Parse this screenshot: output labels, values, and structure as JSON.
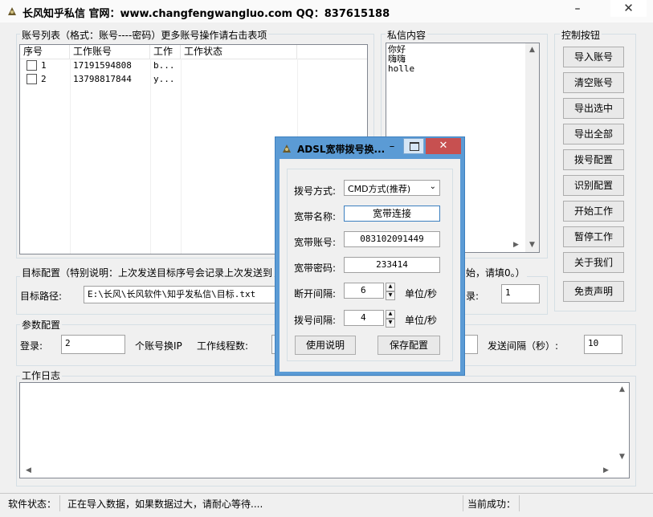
{
  "app": {
    "title": "长风知乎私信 官网：www.changfengwangluo.com QQ：837615188",
    "min": "–",
    "close": "✕"
  },
  "accounts": {
    "legend": "账号列表（格式：账号----密码）更多账号操作请右击表项",
    "columns": [
      "序号",
      "工作账号",
      "工作",
      "工作状态"
    ],
    "rows": [
      {
        "no": "1",
        "account": "17191594808",
        "work": "b..."
      },
      {
        "no": "2",
        "account": "13798817844",
        "work": "y..."
      }
    ]
  },
  "message": {
    "legend": "私信内容",
    "lines": [
      "你好",
      "嗨嗨",
      "holle"
    ]
  },
  "controls": {
    "legend": "控制按钮",
    "buttons": [
      "导入账号",
      "清空账号",
      "导出选中",
      "导出全部",
      "拨号配置",
      "识别配置",
      "开始工作",
      "暂停工作",
      "关于我们",
      "免责声明"
    ]
  },
  "target": {
    "legend": "目标配置（特别说明：上次发送目标序号会记录上次发送到",
    "legend_tail": "始，请填0。）",
    "path_label": "目标路径:",
    "path_value": "E:\\长风\\长风软件\\知乎发私信\\目标.txt",
    "record_label": "录:",
    "record_value": "1"
  },
  "params": {
    "legend": "参数配置",
    "login_label": "登录:",
    "login_value": "2",
    "ip_label": "个账号换IP",
    "threads_label": "工作线程数:",
    "interval_label": "发送间隔（秒）:",
    "interval_value": "10"
  },
  "log": {
    "legend": "工作日志"
  },
  "status": {
    "label": "软件状态：",
    "text": "正在导入数据，如果数据过大，请耐心等待....",
    "success_label": "当前成功："
  },
  "dialog": {
    "title": "ADSL宽带拨号换...",
    "min": "–",
    "close": "✕",
    "dial_label": "拨号方式:",
    "dial_value": "CMD方式(推荐)",
    "name_label": "宽带名称:",
    "name_value": "宽带连接",
    "acct_label": "宽带账号:",
    "acct_value": "083102091449",
    "pwd_label": "宽带密码:",
    "pwd_value": "233414",
    "disc_label": "断开间隔:",
    "disc_value": "6",
    "disc_unit": "单位/秒",
    "redial_label": "拨号间隔:",
    "redial_value": "4",
    "redial_unit": "单位/秒",
    "help_btn": "使用说明",
    "save_btn": "保存配置"
  },
  "colors": {
    "dialog_frame": "#5b9bd5",
    "close_red": "#c75050"
  }
}
